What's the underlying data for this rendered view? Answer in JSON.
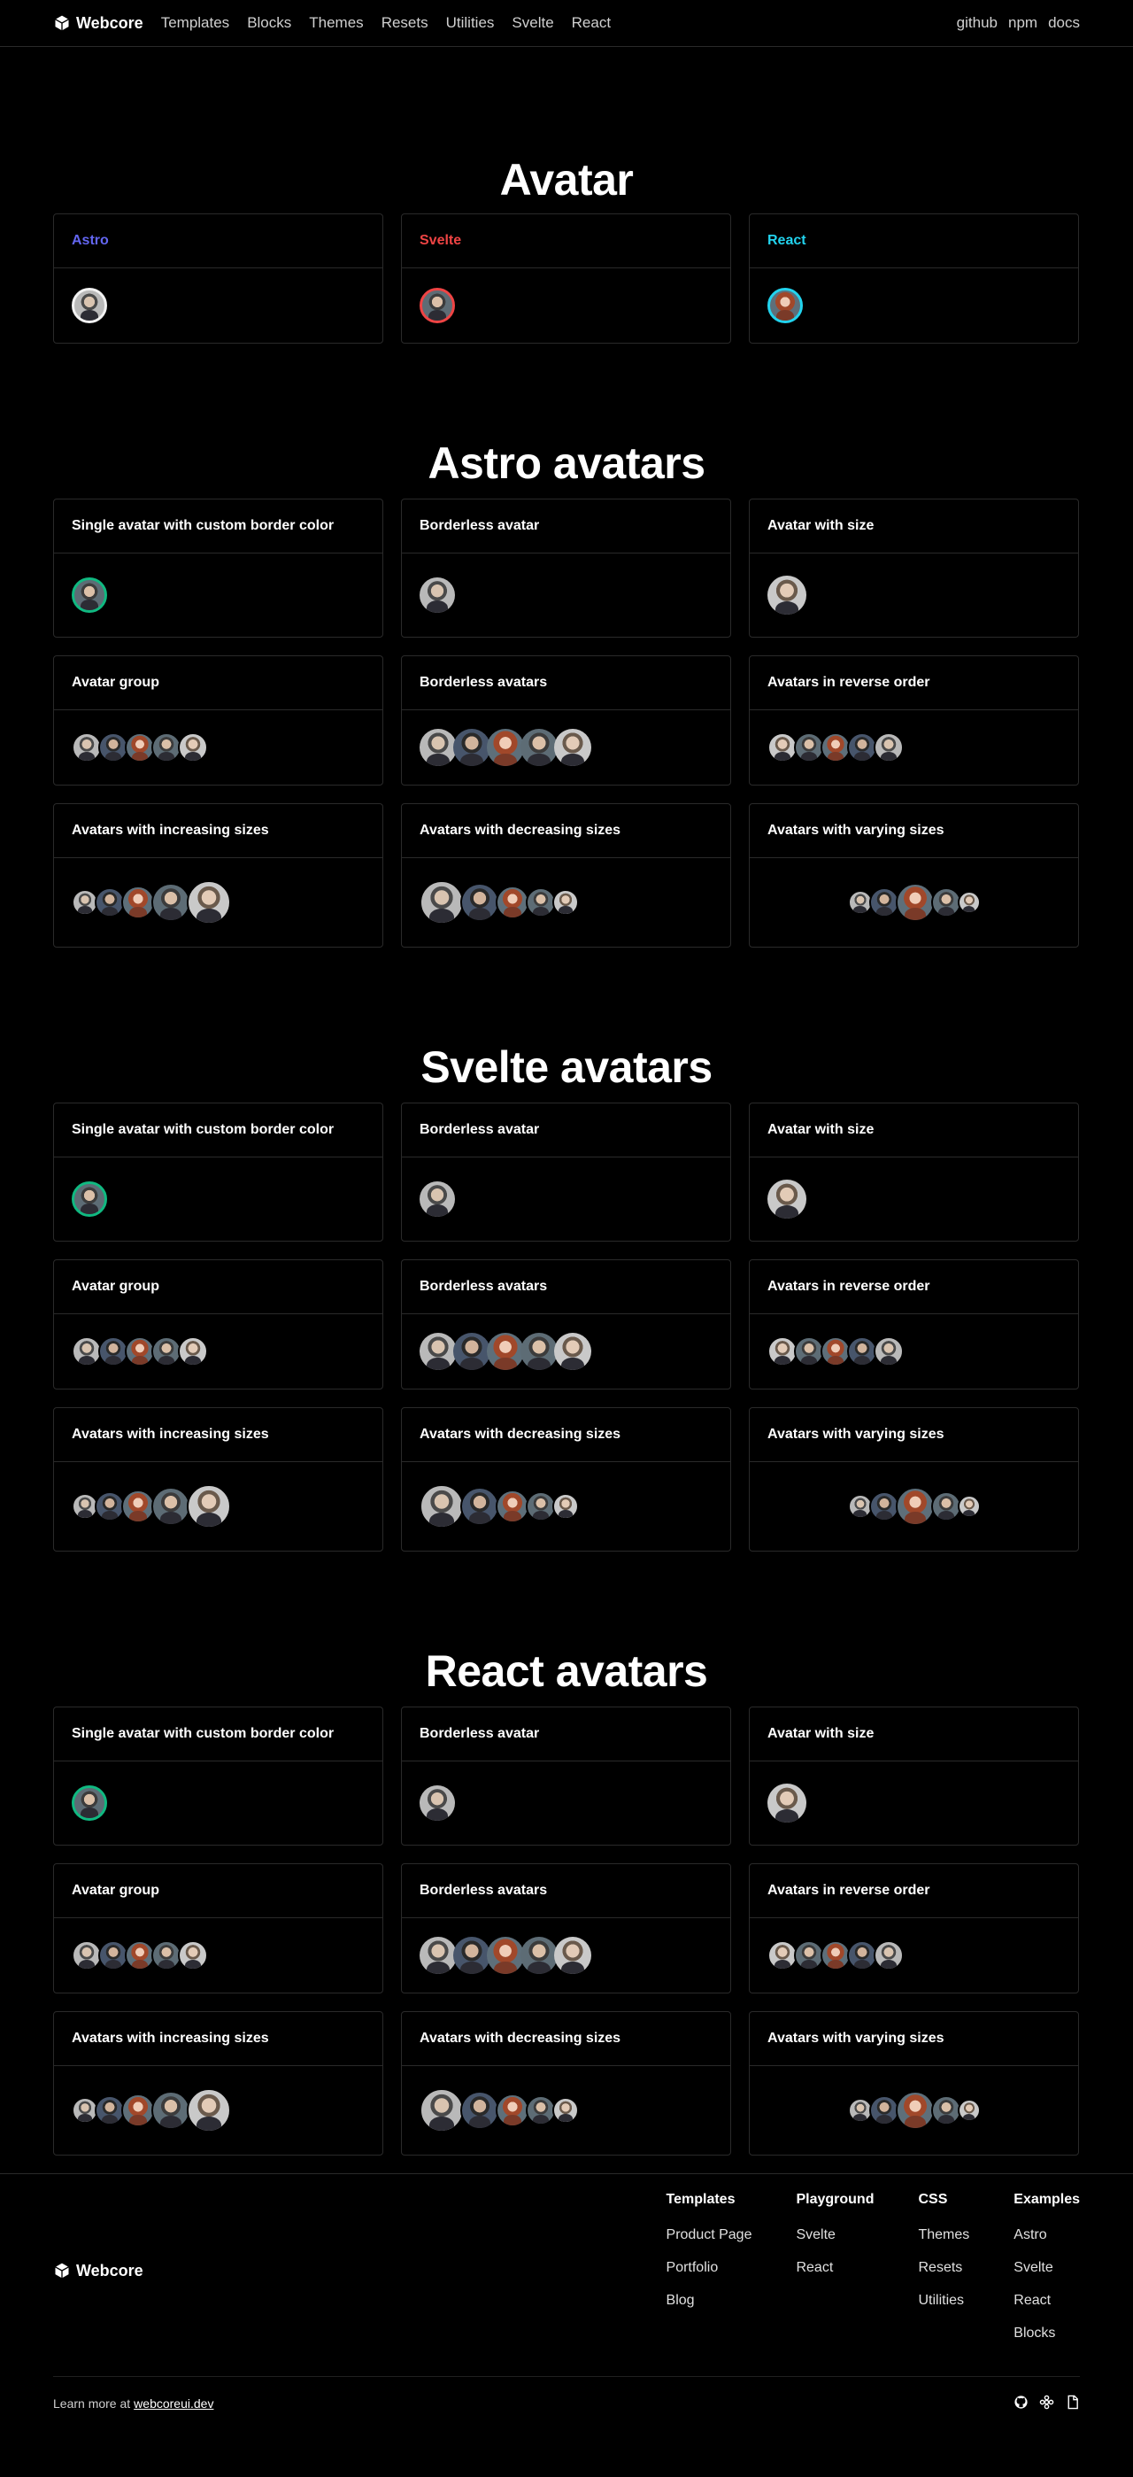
{
  "header": {
    "brand": "Webcore",
    "nav": [
      "Templates",
      "Blocks",
      "Themes",
      "Resets",
      "Utilities",
      "Svelte",
      "React"
    ],
    "nav_right": [
      "github",
      "npm",
      "docs"
    ]
  },
  "intro": {
    "title": "Avatar",
    "cards": [
      {
        "label": "Astro",
        "color": "#6366f1",
        "border": "border-w"
      },
      {
        "label": "Svelte",
        "color": "#ef4444",
        "border": "border-r"
      },
      {
        "label": "React",
        "color": "#22d3ee",
        "border": "border-c"
      }
    ]
  },
  "sections": [
    {
      "title": "Astro avatars"
    },
    {
      "title": "Svelte avatars"
    },
    {
      "title": "React avatars"
    }
  ],
  "cards": [
    "Single avatar with custom border color",
    "Borderless avatar",
    "Avatar with size",
    "Avatar group",
    "Borderless avatars",
    "Avatars in reverse order",
    "Avatars with increasing sizes",
    "Avatars with decreasing sizes",
    "Avatars with varying sizes"
  ],
  "footer": {
    "brand": "Webcore",
    "columns": [
      {
        "title": "Templates",
        "items": [
          "Product Page",
          "Portfolio",
          "Blog"
        ]
      },
      {
        "title": "Playground",
        "items": [
          "Svelte",
          "React"
        ]
      },
      {
        "title": "CSS",
        "items": [
          "Themes",
          "Resets",
          "Utilities"
        ]
      },
      {
        "title": "Examples",
        "items": [
          "Astro",
          "Svelte",
          "React",
          "Blocks"
        ]
      }
    ],
    "learn_more": "Learn more at",
    "link": "webcoreui.dev",
    "icons": [
      "github-icon",
      "figma-icon",
      "docs-icon"
    ]
  }
}
